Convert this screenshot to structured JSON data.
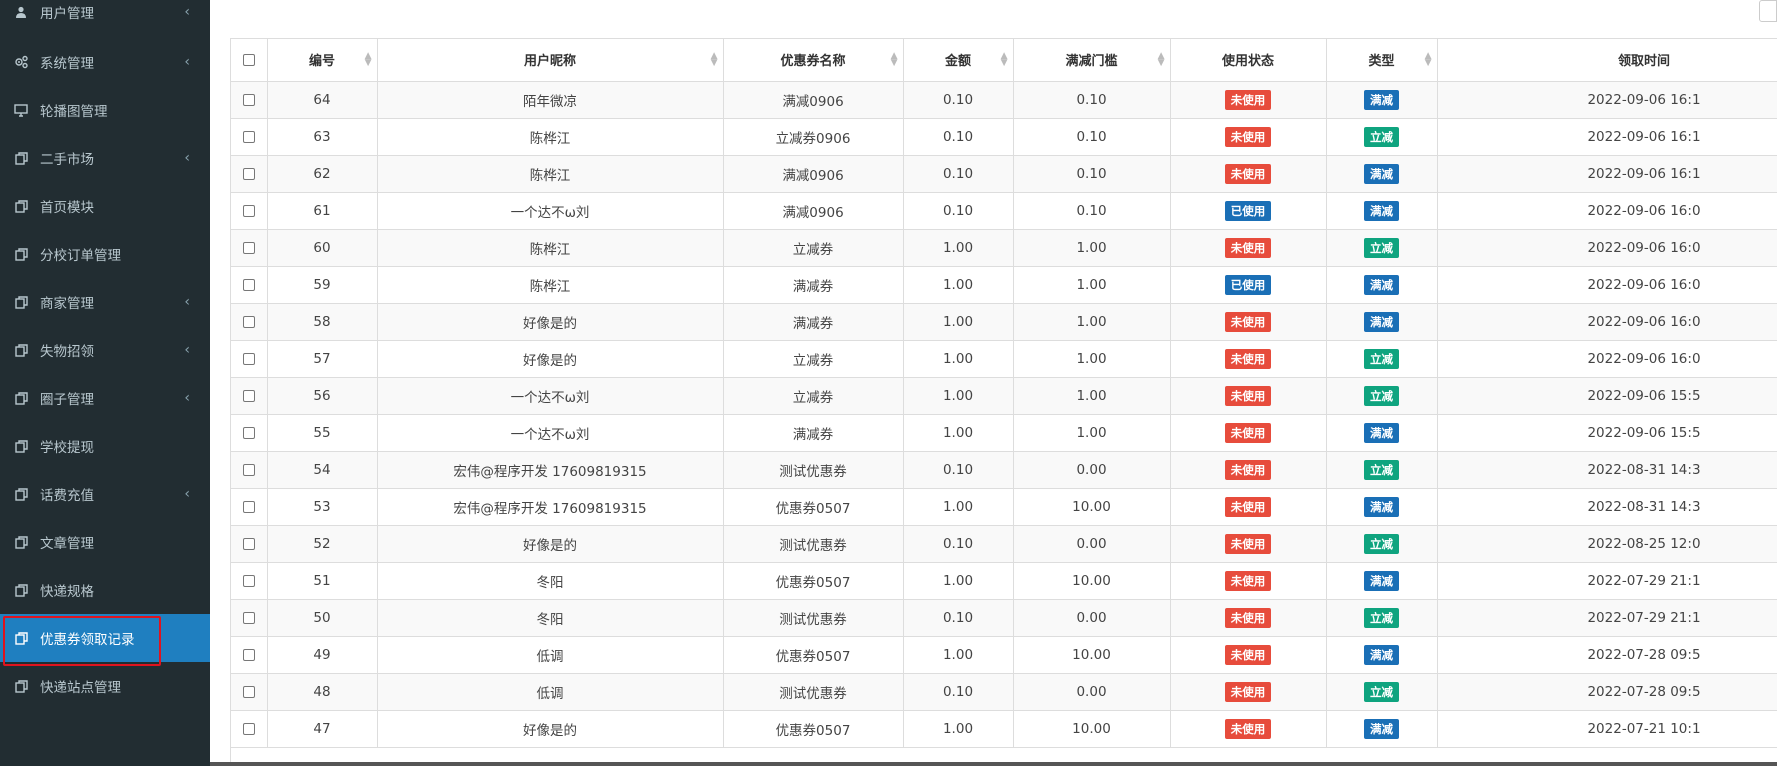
{
  "colors": {
    "sidebar_bg": "#222d32",
    "active_bg": "#1f7fc0",
    "highlight_border": "#e0131e",
    "status_unused": "#e74c3c",
    "status_used": "#1a6fb6",
    "type_manjian": "#1a6fb6",
    "type_lijian": "#0fa47f"
  },
  "sidebar": {
    "items": [
      {
        "label": "用户管理",
        "icon": "user-icon",
        "chevron": true
      },
      {
        "label": "系统管理",
        "icon": "gears-icon",
        "chevron": true
      },
      {
        "label": "轮播图管理",
        "icon": "monitor-icon",
        "chevron": false
      },
      {
        "label": "二手市场",
        "icon": "copy-icon",
        "chevron": true
      },
      {
        "label": "首页模块",
        "icon": "copy-icon",
        "chevron": false
      },
      {
        "label": "分校订单管理",
        "icon": "copy-icon",
        "chevron": false
      },
      {
        "label": "商家管理",
        "icon": "copy-icon",
        "chevron": true
      },
      {
        "label": "失物招领",
        "icon": "copy-icon",
        "chevron": true
      },
      {
        "label": "圈子管理",
        "icon": "copy-icon",
        "chevron": true
      },
      {
        "label": "学校提现",
        "icon": "copy-icon",
        "chevron": false
      },
      {
        "label": "话费充值",
        "icon": "copy-icon",
        "chevron": true
      },
      {
        "label": "文章管理",
        "icon": "copy-icon",
        "chevron": false
      },
      {
        "label": "快递规格",
        "icon": "copy-icon",
        "chevron": false
      },
      {
        "label": "优惠券领取记录",
        "icon": "copy-icon",
        "chevron": false,
        "active": true
      },
      {
        "label": "快递站点管理",
        "icon": "copy-icon",
        "chevron": false
      }
    ]
  },
  "table": {
    "columns": [
      "编号",
      "用户昵称",
      "优惠券名称",
      "金额",
      "满减门槛",
      "使用状态",
      "类型",
      "领取时间"
    ],
    "rows": [
      {
        "id": "64",
        "nick": "陌年微凉",
        "name": "满减0906",
        "amount": "0.10",
        "threshold": "0.10",
        "status": "未使用",
        "type": "满减",
        "time": "2022-09-06 16:1"
      },
      {
        "id": "63",
        "nick": "陈桦江",
        "name": "立减券0906",
        "amount": "0.10",
        "threshold": "0.10",
        "status": "未使用",
        "type": "立减",
        "time": "2022-09-06 16:1"
      },
      {
        "id": "62",
        "nick": "陈桦江",
        "name": "满减0906",
        "amount": "0.10",
        "threshold": "0.10",
        "status": "未使用",
        "type": "满减",
        "time": "2022-09-06 16:1"
      },
      {
        "id": "61",
        "nick": "一个达不ω刘",
        "name": "满减0906",
        "amount": "0.10",
        "threshold": "0.10",
        "status": "已使用",
        "type": "满减",
        "time": "2022-09-06 16:0"
      },
      {
        "id": "60",
        "nick": "陈桦江",
        "name": "立减券",
        "amount": "1.00",
        "threshold": "1.00",
        "status": "未使用",
        "type": "立减",
        "time": "2022-09-06 16:0"
      },
      {
        "id": "59",
        "nick": "陈桦江",
        "name": "满减券",
        "amount": "1.00",
        "threshold": "1.00",
        "status": "已使用",
        "type": "满减",
        "time": "2022-09-06 16:0"
      },
      {
        "id": "58",
        "nick": "好像是的",
        "name": "满减券",
        "amount": "1.00",
        "threshold": "1.00",
        "status": "未使用",
        "type": "满减",
        "time": "2022-09-06 16:0"
      },
      {
        "id": "57",
        "nick": "好像是的",
        "name": "立减券",
        "amount": "1.00",
        "threshold": "1.00",
        "status": "未使用",
        "type": "立减",
        "time": "2022-09-06 16:0"
      },
      {
        "id": "56",
        "nick": "一个达不ω刘",
        "name": "立减券",
        "amount": "1.00",
        "threshold": "1.00",
        "status": "未使用",
        "type": "立减",
        "time": "2022-09-06 15:5"
      },
      {
        "id": "55",
        "nick": "一个达不ω刘",
        "name": "满减券",
        "amount": "1.00",
        "threshold": "1.00",
        "status": "未使用",
        "type": "满减",
        "time": "2022-09-06 15:5"
      },
      {
        "id": "54",
        "nick": "宏伟@程序开发 17609819315",
        "name": "测试优惠券",
        "amount": "0.10",
        "threshold": "0.00",
        "status": "未使用",
        "type": "立减",
        "time": "2022-08-31 14:3"
      },
      {
        "id": "53",
        "nick": "宏伟@程序开发 17609819315",
        "name": "优惠券0507",
        "amount": "1.00",
        "threshold": "10.00",
        "status": "未使用",
        "type": "满减",
        "time": "2022-08-31 14:3"
      },
      {
        "id": "52",
        "nick": "好像是的",
        "name": "测试优惠券",
        "amount": "0.10",
        "threshold": "0.00",
        "status": "未使用",
        "type": "立减",
        "time": "2022-08-25 12:0"
      },
      {
        "id": "51",
        "nick": "冬阳",
        "name": "优惠券0507",
        "amount": "1.00",
        "threshold": "10.00",
        "status": "未使用",
        "type": "满减",
        "time": "2022-07-29 21:1"
      },
      {
        "id": "50",
        "nick": "冬阳",
        "name": "测试优惠券",
        "amount": "0.10",
        "threshold": "0.00",
        "status": "未使用",
        "type": "立减",
        "time": "2022-07-29 21:1"
      },
      {
        "id": "49",
        "nick": "低调",
        "name": "优惠券0507",
        "amount": "1.00",
        "threshold": "10.00",
        "status": "未使用",
        "type": "满减",
        "time": "2022-07-28 09:5"
      },
      {
        "id": "48",
        "nick": "低调",
        "name": "测试优惠券",
        "amount": "0.10",
        "threshold": "0.00",
        "status": "未使用",
        "type": "立减",
        "time": "2022-07-28 09:5"
      },
      {
        "id": "47",
        "nick": "好像是的",
        "name": "优惠券0507",
        "amount": "1.00",
        "threshold": "10.00",
        "status": "未使用",
        "type": "满减",
        "time": "2022-07-21 10:1"
      }
    ]
  }
}
